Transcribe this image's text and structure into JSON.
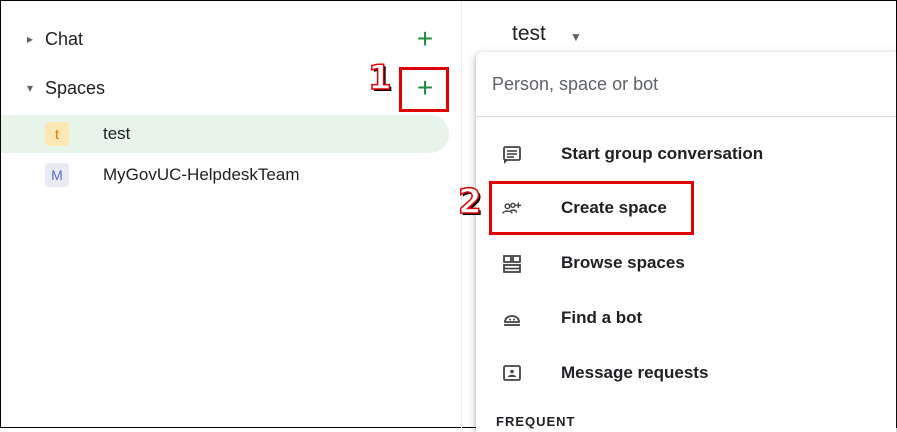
{
  "sidebar": {
    "chat_label": "Chat",
    "spaces_label": "Spaces",
    "spaces": [
      {
        "initial": "t",
        "name": "test",
        "avatar_bg": "#fce8b2",
        "avatar_fg": "#e37400",
        "selected": true
      },
      {
        "initial": "M",
        "name": "MyGovUC-HelpdeskTeam",
        "avatar_bg": "#e8eaf6",
        "avatar_fg": "#5c6bc0",
        "selected": false
      }
    ]
  },
  "header": {
    "title": "test"
  },
  "menu": {
    "search_placeholder": "Person, space or bot",
    "items": [
      {
        "label": "Start group conversation",
        "icon": "chat-icon"
      },
      {
        "label": "Create space",
        "icon": "add-group-icon"
      },
      {
        "label": "Browse spaces",
        "icon": "browse-spaces-icon"
      },
      {
        "label": "Find a bot",
        "icon": "bot-icon"
      },
      {
        "label": "Message requests",
        "icon": "message-request-icon"
      }
    ],
    "section_label": "FREQUENT"
  },
  "annotations": {
    "step1": "1",
    "step2": "2",
    "highlight_color": "#e00000"
  },
  "colors": {
    "accent_green": "#1e8e3e",
    "selected_bg": "#e6f4ea"
  }
}
